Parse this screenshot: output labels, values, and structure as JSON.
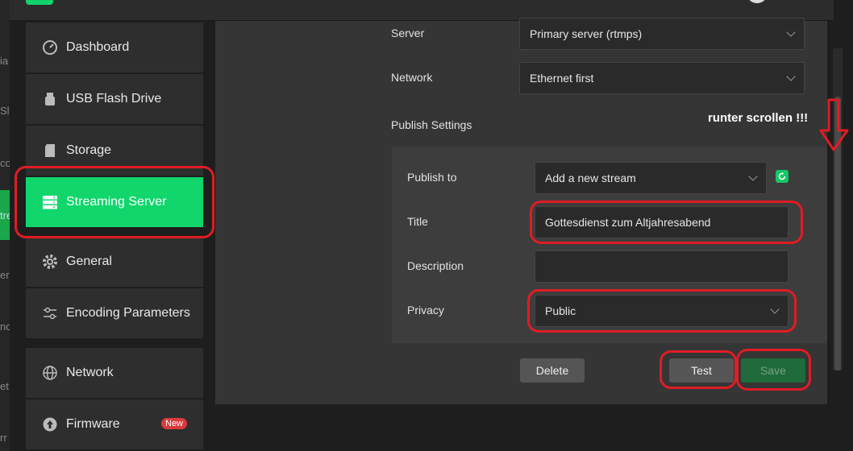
{
  "background": {
    "fragments": [
      "ia",
      "Sl",
      "co",
      "tre",
      "er",
      "nc",
      "et",
      "rr"
    ]
  },
  "sidebar": {
    "items": [
      {
        "label": "Dashboard",
        "icon": "dashboard-gauge-icon"
      },
      {
        "label": "USB Flash Drive",
        "icon": "usb-drive-icon"
      },
      {
        "label": "Storage",
        "icon": "sd-card-icon"
      },
      {
        "label": "Streaming Server",
        "icon": "server-icon",
        "active": true
      },
      {
        "label": "General",
        "icon": "gear-icon"
      },
      {
        "label": "Encoding Parameters",
        "icon": "sliders-icon"
      },
      {
        "label": "Network",
        "icon": "globe-icon"
      },
      {
        "label": "Firmware",
        "icon": "upload-icon",
        "badge": "New"
      }
    ]
  },
  "form": {
    "server_label": "Server",
    "server_value": "Primary server (rtmps)",
    "network_label": "Network",
    "network_value": "Ethernet first",
    "publish_settings_label": "Publish Settings",
    "publish_to_label": "Publish to",
    "publish_to_value": "Add a new stream",
    "title_label": "Title",
    "title_value": "Gottesdienst zum Altjahresabend",
    "description_label": "Description",
    "description_value": "",
    "privacy_label": "Privacy",
    "privacy_value": "Public"
  },
  "buttons": {
    "delete": "Delete",
    "test": "Test",
    "save": "Save"
  },
  "annotation": {
    "text": "runter scrollen !!!"
  },
  "colors": {
    "accent": "#10d66c",
    "annotation": "#e01c24",
    "badge": "#d93a3a"
  }
}
